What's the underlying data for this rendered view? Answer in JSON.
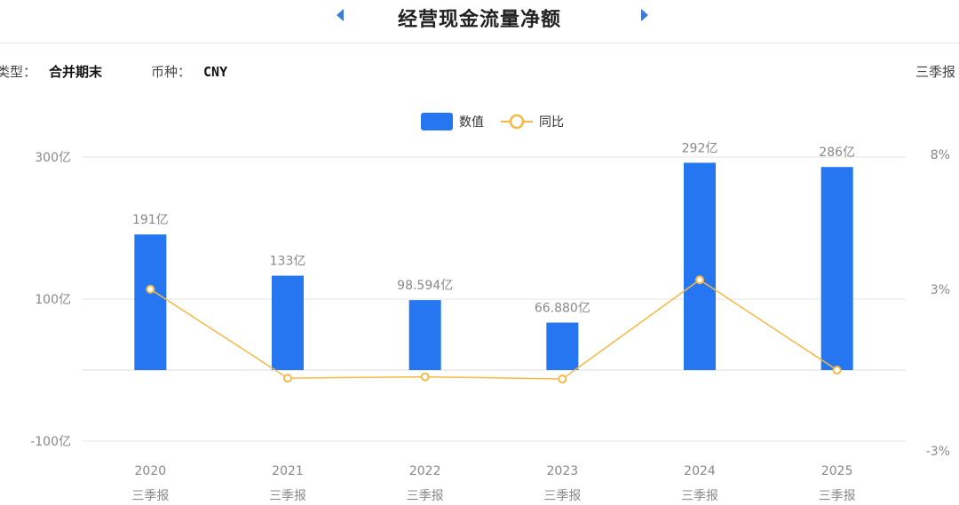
{
  "header": {
    "title": "经营现金流量净额"
  },
  "info": {
    "type_label": "类型：",
    "type_value": "合并期末",
    "currency_label": "币种：",
    "currency_value": "CNY",
    "period": "三季报"
  },
  "chart_data": {
    "type": "bar",
    "categories": [
      "2020",
      "2021",
      "2022",
      "2023",
      "2024",
      "2025"
    ],
    "category_sublabels": [
      "三季报",
      "三季报",
      "三季报",
      "三季报",
      "三季报",
      "三季报"
    ],
    "series": [
      {
        "name": "数值",
        "type": "bar",
        "axis": "left",
        "values": [
          191,
          133,
          98.594,
          66.88,
          292,
          286
        ],
        "labels": [
          "191亿",
          "133亿",
          "98.594亿",
          "66.880亿",
          "292亿",
          "286亿"
        ],
        "color": "#2576f0"
      },
      {
        "name": "同比",
        "type": "line",
        "axis": "right",
        "values": [
          3.0,
          -0.3,
          -0.25,
          -0.33,
          3.35,
          0.0
        ],
        "color": "#f5b943"
      }
    ],
    "y_left": {
      "ticks": [
        300,
        100,
        -100
      ],
      "tick_labels": [
        "300亿",
        "100亿",
        "-100亿"
      ]
    },
    "y_right": {
      "ticks": [
        8,
        3,
        -3
      ],
      "tick_labels": [
        "8%",
        "3%",
        "-3%"
      ]
    },
    "legend_position": "top-center",
    "grid": true
  }
}
